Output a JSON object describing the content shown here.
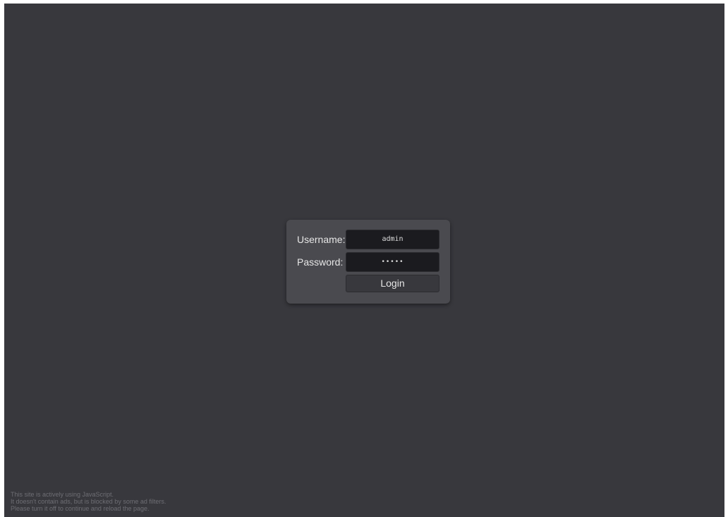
{
  "login": {
    "username_label": "Username:",
    "password_label": "Password:",
    "username_value": "admin",
    "password_value": "•••••",
    "button_label": "Login"
  },
  "notice": {
    "lines": [
      "This site is actively using JavaScript.",
      "It doesn't contain ads, but is blocked by some ad filters.",
      "Please turn it off to continue and reload the page."
    ]
  },
  "colors": {
    "background": "#38383d",
    "panel": "#4a4a4f",
    "field": "#1b1b1f",
    "text": "#e6e6e6",
    "notice_text": "#6e6e74"
  }
}
